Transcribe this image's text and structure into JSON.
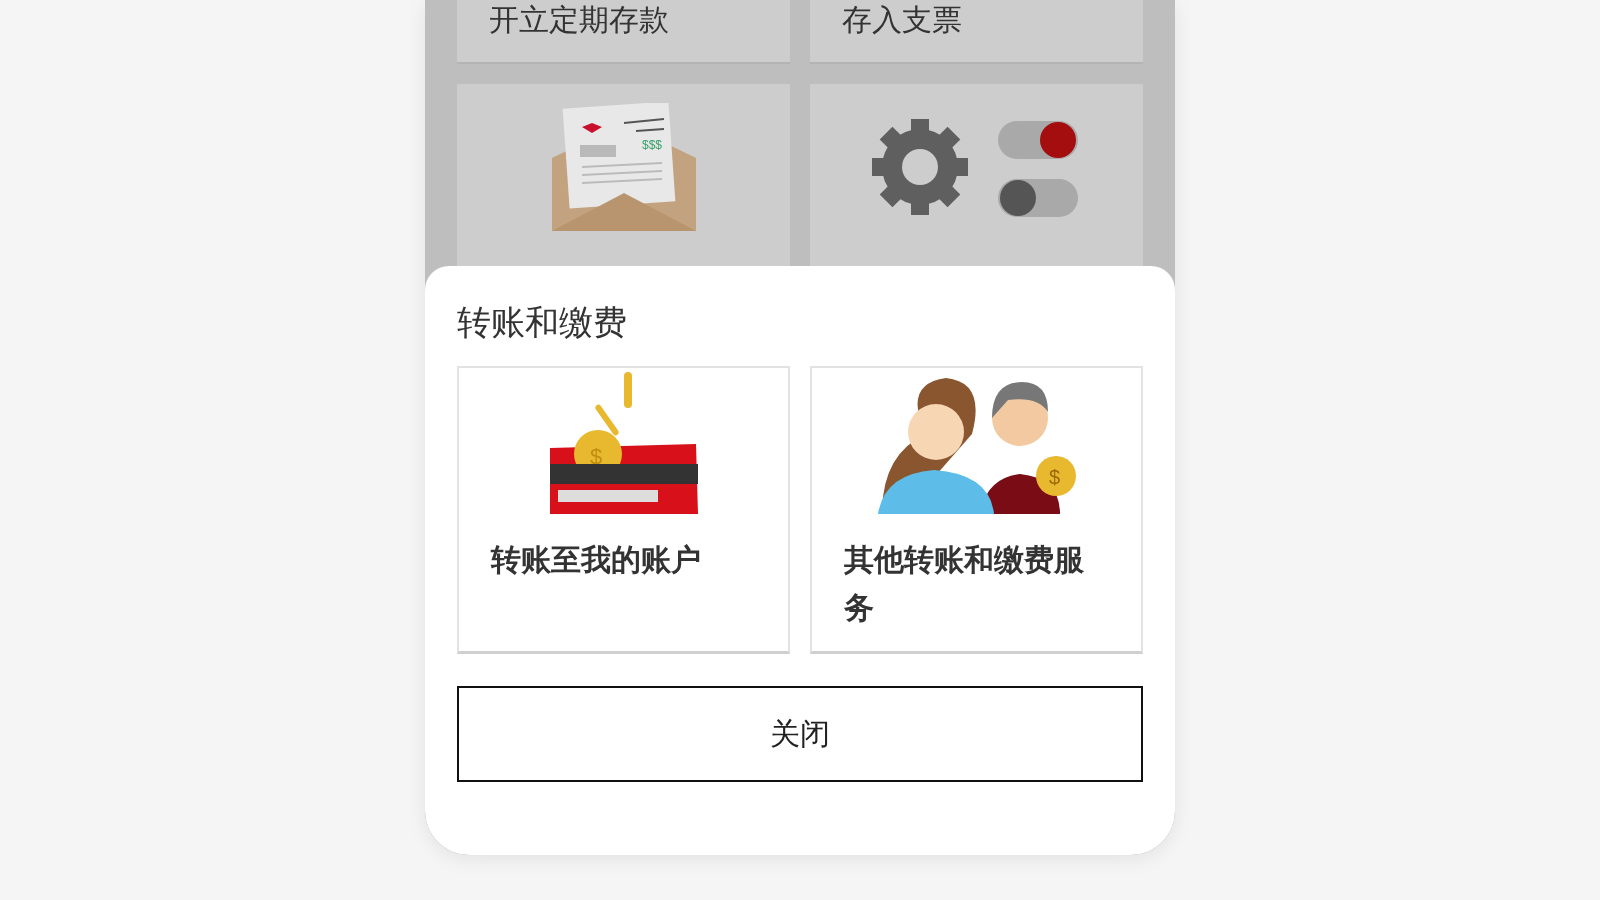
{
  "background_tiles": [
    {
      "label": "开立定期存款",
      "kind": "plain"
    },
    {
      "label": "存入支票",
      "kind": "plain"
    },
    {
      "kind": "envelope",
      "symbol": "$$$"
    },
    {
      "kind": "settings"
    }
  ],
  "sheet": {
    "title": "转账和缴费",
    "tiles": [
      {
        "label": "转账至我的账户",
        "kind": "card",
        "symbol": "$"
      },
      {
        "label": "其他转账和缴费服务",
        "kind": "people",
        "symbol": "$"
      }
    ],
    "close_button": "关闭"
  }
}
